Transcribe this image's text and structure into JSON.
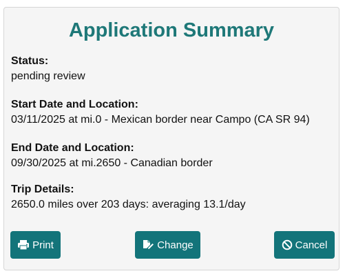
{
  "summary": {
    "title": "Application Summary",
    "status_label": "Status:",
    "status_value": "pending review",
    "start_label": "Start Date and Location:",
    "start_value": "03/11/2025 at mi.0 - Mexican border near Campo (CA SR 94)",
    "end_label": "End Date and Location:",
    "end_value": "09/30/2025 at mi.2650 - Canadian border",
    "trip_label": "Trip Details:",
    "trip_value": "2650.0 miles over 203 days: averaging 13.1/day"
  },
  "actions": {
    "print_label": "Print",
    "print_icon": "printer-icon",
    "change_label": "Change",
    "change_icon": "edit-icon",
    "cancel_label": "Cancel",
    "cancel_icon": "ban-icon"
  },
  "colors": {
    "accent": "#1e7878",
    "button": "#13747a"
  }
}
